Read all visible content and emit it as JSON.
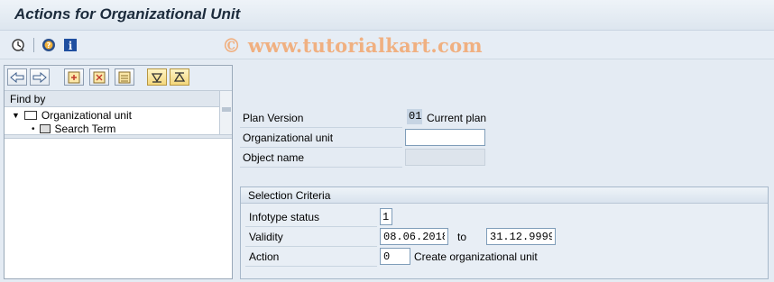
{
  "window": {
    "title": "Actions for Organizational Unit"
  },
  "watermark": "© www.tutorialkart.com",
  "toolbar": {
    "icons": [
      "execute-icon",
      "help-icon",
      "info-icon"
    ]
  },
  "left_pane": {
    "find_by_label": "Find by",
    "tree": [
      {
        "label": "Organizational unit",
        "expanded": true
      },
      {
        "label": "Search Term"
      }
    ]
  },
  "form": {
    "plan_version": {
      "label": "Plan Version",
      "code": "01",
      "text": "Current plan"
    },
    "org_unit": {
      "label": "Organizational unit",
      "value": ""
    },
    "object_name": {
      "label": "Object name",
      "value": ""
    }
  },
  "selection_criteria": {
    "title": "Selection Criteria",
    "infotype_status": {
      "label": "Infotype status",
      "value": "1"
    },
    "validity": {
      "label": "Validity",
      "from": "08.06.2018",
      "to_label": "to",
      "to": "31.12.9999"
    },
    "action": {
      "label": "Action",
      "value": "0",
      "text": "Create organizational unit"
    }
  },
  "colors": {
    "title": "#1c2b3c",
    "background": "#e4ebf3",
    "watermark": "#f0b081"
  }
}
